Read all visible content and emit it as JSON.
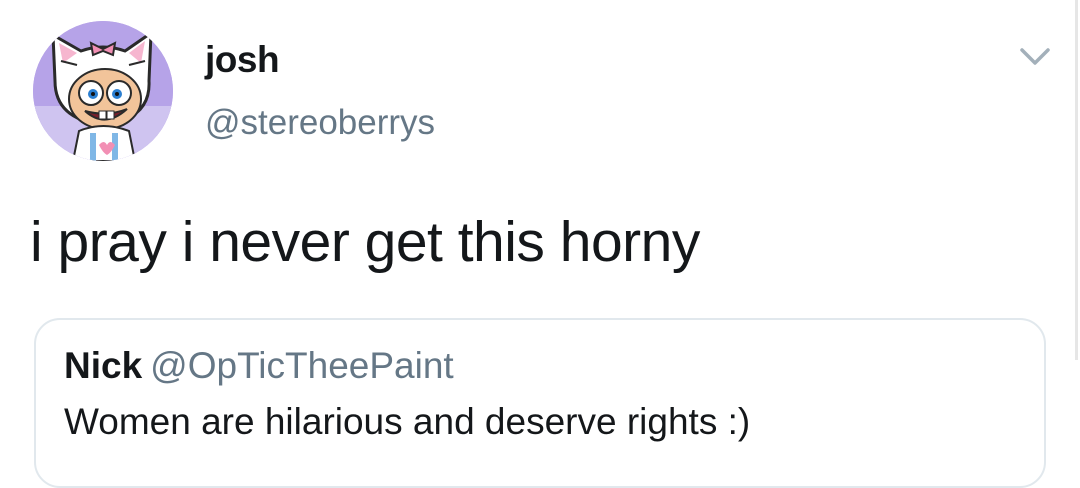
{
  "tweet": {
    "author": {
      "display_name": "josh",
      "handle": "@stereoberrys"
    },
    "text": "i pray i never get this horny",
    "menu_icon": "chevron-down-icon"
  },
  "quoted_tweet": {
    "author": {
      "display_name": "Nick",
      "handle": "@OpTicTheePaint"
    },
    "text": "Women are hilarious and deserve rights :)"
  },
  "colors": {
    "text_primary": "#14171a",
    "text_secondary": "#657786",
    "border": "#e1e8ed",
    "chevron": "#a3b0ba"
  }
}
